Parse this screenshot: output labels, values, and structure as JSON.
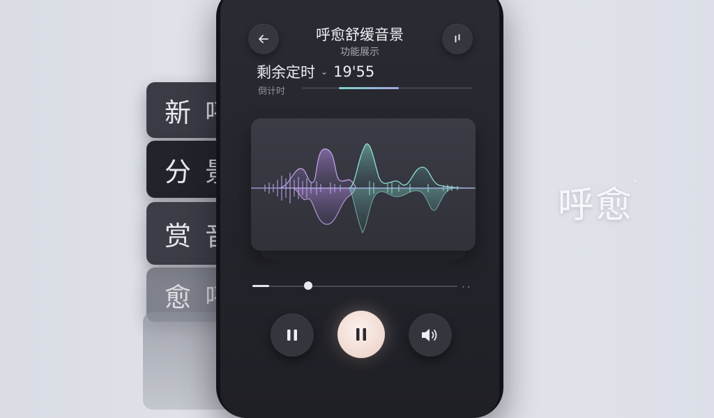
{
  "side_cards": [
    {
      "char1": "新",
      "char2": "呼"
    },
    {
      "char1": "分",
      "char2": "景"
    },
    {
      "char1": "赏",
      "char2": "音"
    },
    {
      "char1": "愈",
      "char2": "呼"
    }
  ],
  "header": {
    "title": "呼愈舒缓音景",
    "subtitle": "功能展示",
    "back_icon": "arrow-left-icon",
    "menu_icon": "more-vertical-icon"
  },
  "timer": {
    "label": "剩余定时",
    "value": "19'55",
    "sub_label": "倒计时",
    "progress": 0.35
  },
  "player": {
    "seek_progress": 0.25,
    "controls": [
      "pause-icon",
      "pause-icon",
      "volume-icon"
    ]
  },
  "brand": {
    "name": "呼愈",
    "mark": "°"
  },
  "colors": {
    "accent_teal": "#7fd6c8",
    "accent_purple": "#b58ce6",
    "play_button": "#f1dcd3"
  }
}
